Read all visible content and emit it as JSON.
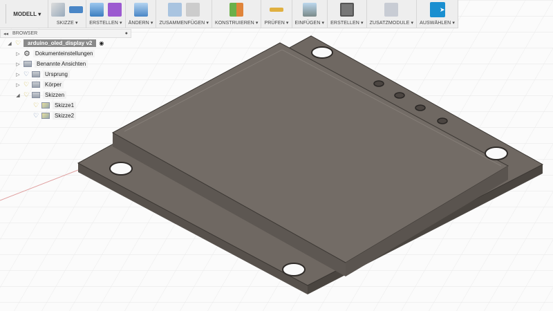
{
  "toolbar": {
    "workspace": "MODELL",
    "groups": [
      {
        "label": "SKIZZE ▾",
        "icons": [
          "sketch-icon",
          "stop-sketch-icon"
        ]
      },
      {
        "label": "ERSTELLEN ▾",
        "icons": [
          "extrude-icon",
          "form-icon"
        ]
      },
      {
        "label": "ÄNDERN ▾",
        "icons": [
          "press-pull-icon"
        ]
      },
      {
        "label": "ZUSAMMENFÜGEN ▾",
        "icons": [
          "new-component-icon",
          "joint-icon"
        ]
      },
      {
        "label": "KONSTRUIEREN ▾",
        "icons": [
          "offset-plane-icon"
        ]
      },
      {
        "label": "PRÜFEN ▾",
        "icons": [
          "measure-icon"
        ]
      },
      {
        "label": "EINFÜGEN ▾",
        "icons": [
          "insert-image-icon"
        ]
      },
      {
        "label": "ERSTELLEN ▾",
        "icons": [
          "render-icon"
        ]
      },
      {
        "label": "ZUSATZMODULE ▾",
        "icons": [
          "scripts-icon"
        ]
      },
      {
        "label": "AUSWÄHLEN ▾",
        "icons": [
          "select-icon"
        ]
      }
    ]
  },
  "browser": {
    "title": "BROWSER",
    "root": "arduino_oled_display v2",
    "items": [
      {
        "label": "Dokumenteinstellungen",
        "icon": "gear-icon"
      },
      {
        "label": "Benannte Ansichten",
        "icon": "folder-icon"
      },
      {
        "label": "Ursprung",
        "icon": "folder-icon"
      },
      {
        "label": "Körper",
        "icon": "folder-icon"
      },
      {
        "label": "Skizzen",
        "icon": "folder-icon"
      },
      {
        "label": "Skizze1",
        "icon": "sketch-icon"
      },
      {
        "label": "Skizze2",
        "icon": "sketch-icon"
      }
    ]
  },
  "colors": {
    "accent": "#1a8fd0",
    "model": "#6f6862"
  }
}
